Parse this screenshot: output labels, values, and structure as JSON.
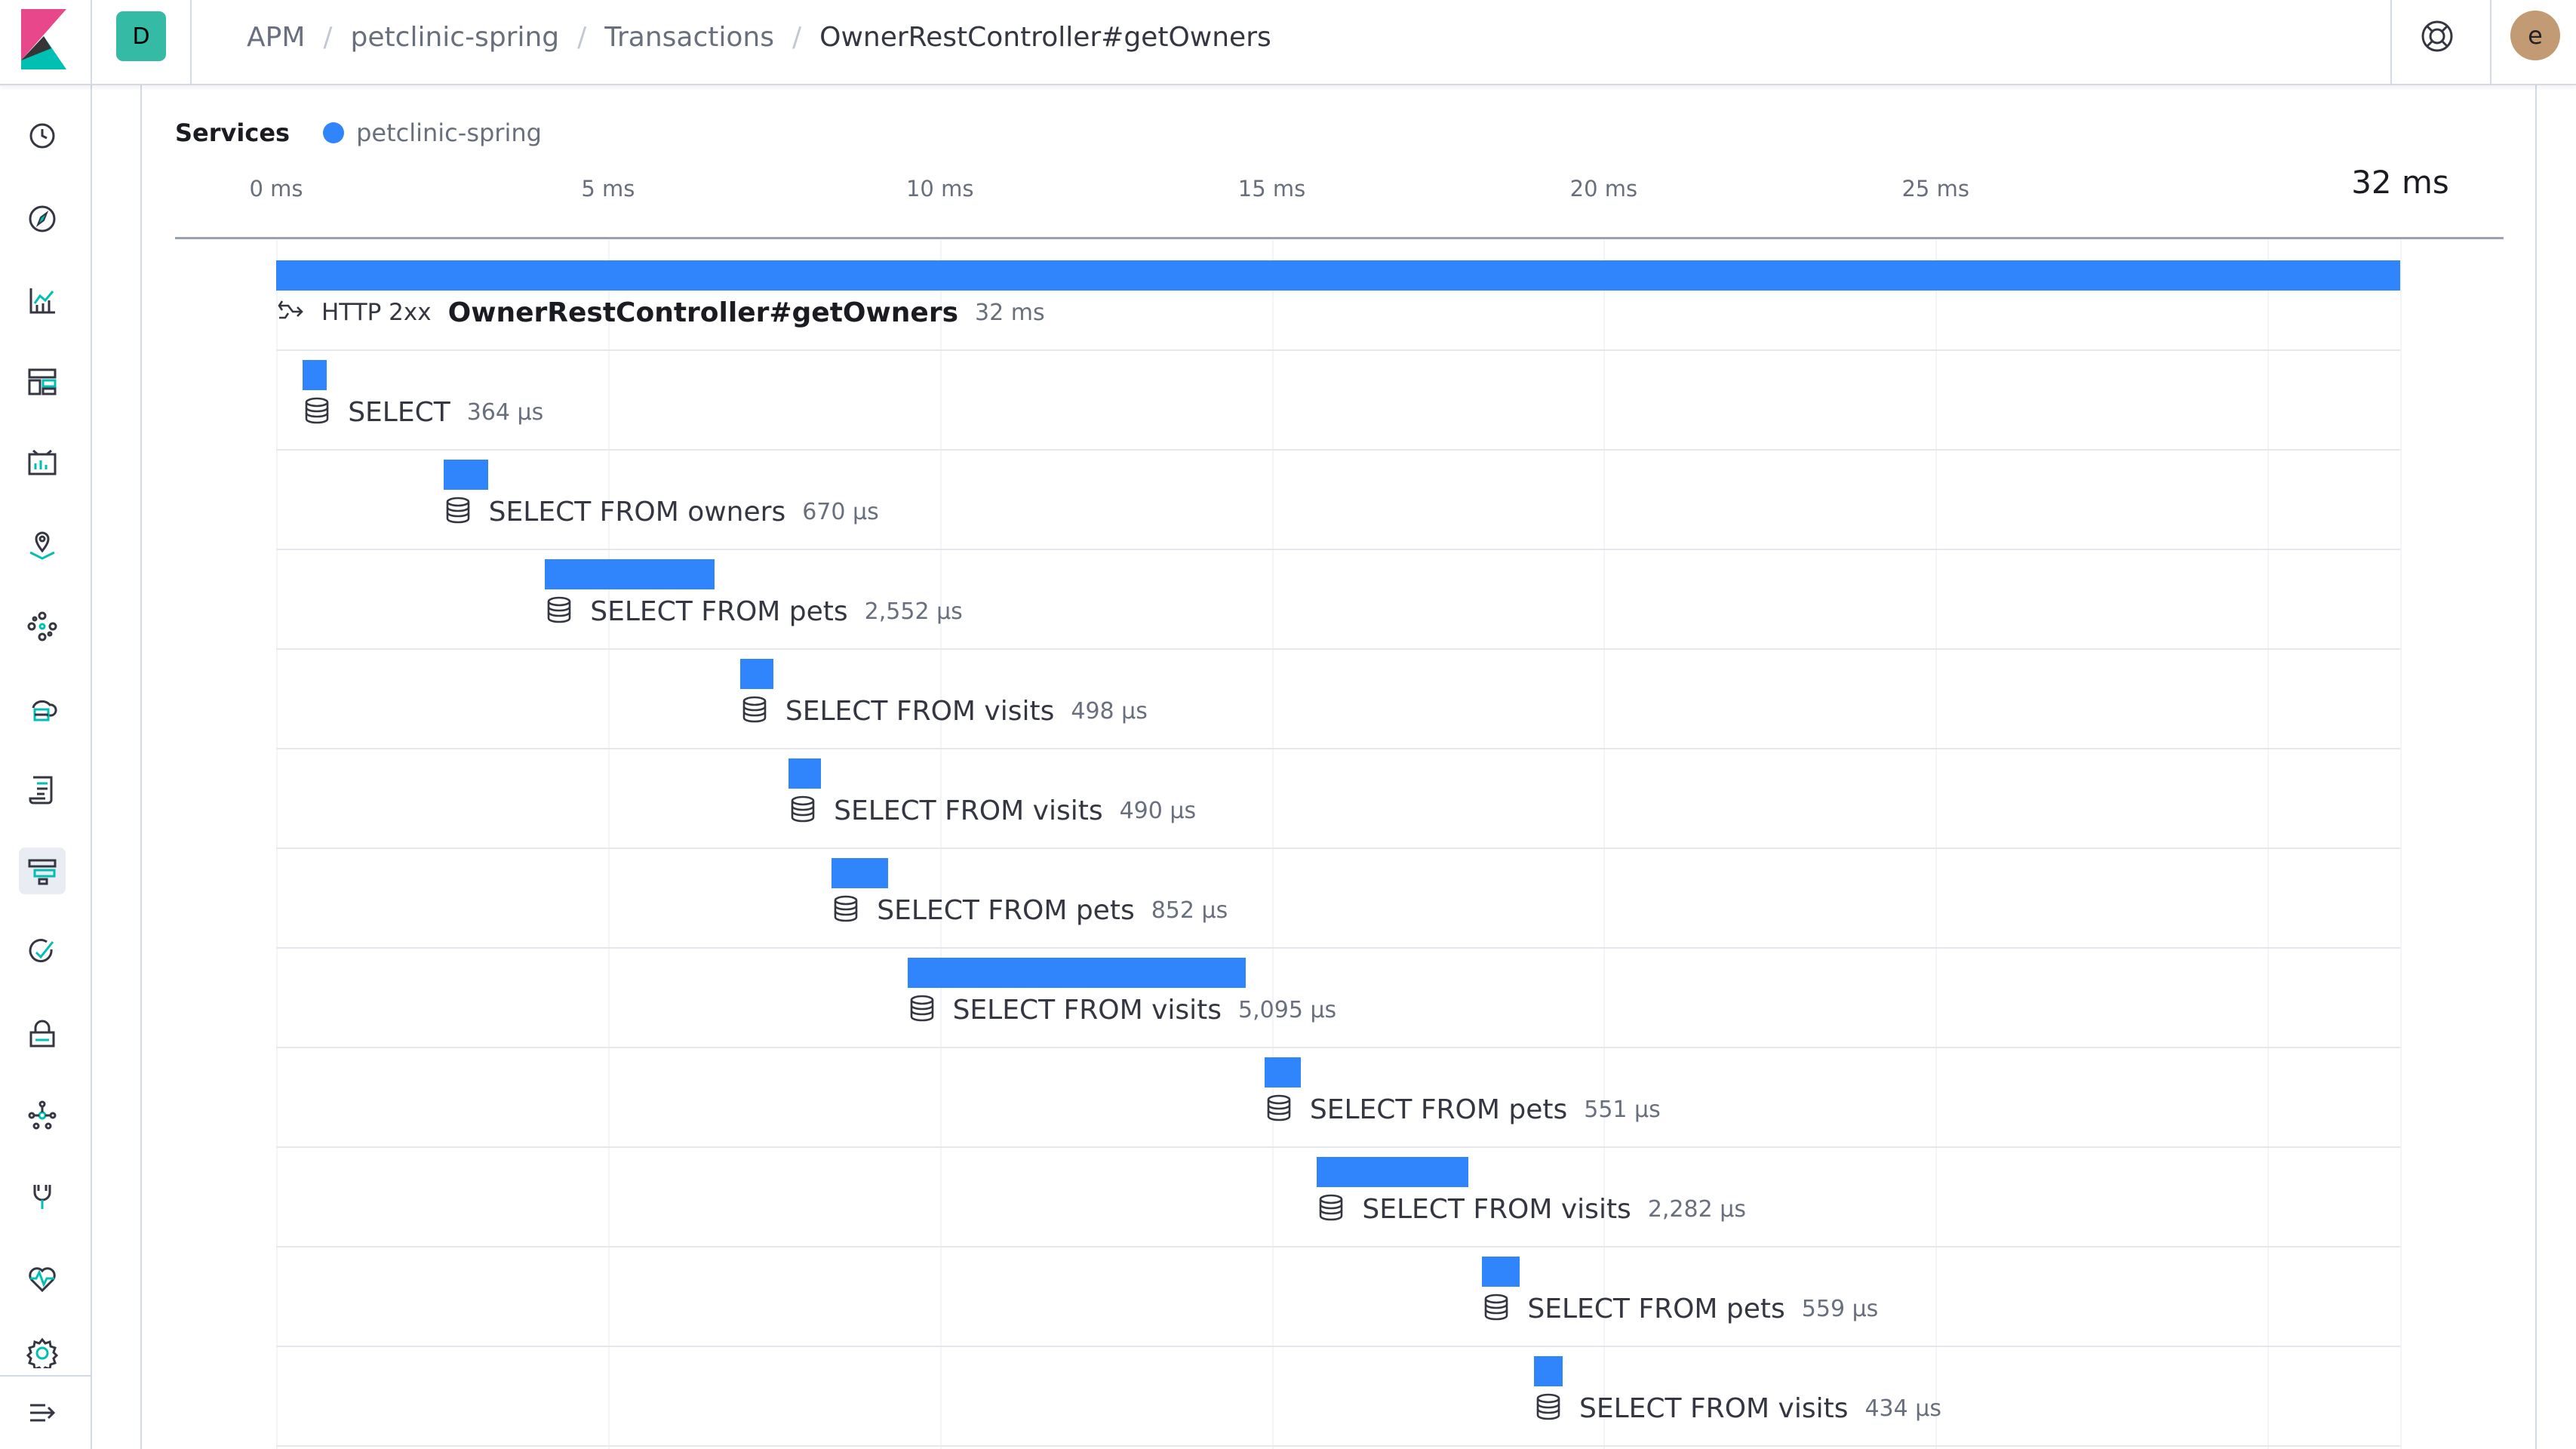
{
  "header": {
    "space_initial": "D",
    "breadcrumbs": [
      "APM",
      "petclinic-spring",
      "Transactions",
      "OwnerRestController#getOwners"
    ],
    "user_initial": "e"
  },
  "nav": {
    "icons": [
      "recently-viewed-icon",
      "discover-icon",
      "visualize-icon",
      "dashboard-icon",
      "canvas-icon",
      "maps-icon",
      "machine-learning-icon",
      "infrastructure-icon",
      "logs-icon",
      "apm-icon",
      "uptime-icon",
      "siem-icon",
      "graph-icon",
      "dev-tools-icon",
      "monitoring-icon",
      "management-icon",
      "collapse-icon"
    ],
    "active": "apm-icon"
  },
  "legend": {
    "title": "Services",
    "service": "petclinic-spring",
    "service_color": "#3185fc"
  },
  "timeline": {
    "ticks": [
      "0 ms",
      "5 ms",
      "10 ms",
      "15 ms",
      "20 ms",
      "25 ms"
    ],
    "end_label": "32 ms",
    "total_ms": 32
  },
  "transaction": {
    "status": "HTTP 2xx",
    "name": "OwnerRestController#getOwners",
    "duration": "32 ms",
    "start_ms": 0,
    "duration_ms": 32
  },
  "spans": [
    {
      "name": "SELECT",
      "duration": "364 μs",
      "start_ms": 0.4,
      "duration_ms": 0.364
    },
    {
      "name": "SELECT FROM owners",
      "duration": "670 μs",
      "start_ms": 2.52,
      "duration_ms": 0.67
    },
    {
      "name": "SELECT FROM pets",
      "duration": "2,552 μs",
      "start_ms": 4.05,
      "duration_ms": 2.552
    },
    {
      "name": "SELECT FROM visits",
      "duration": "498 μs",
      "start_ms": 6.99,
      "duration_ms": 0.498
    },
    {
      "name": "SELECT FROM visits",
      "duration": "490 μs",
      "start_ms": 7.72,
      "duration_ms": 0.49
    },
    {
      "name": "SELECT FROM pets",
      "duration": "852 μs",
      "start_ms": 8.37,
      "duration_ms": 0.852
    },
    {
      "name": "SELECT FROM visits",
      "duration": "5,095 μs",
      "start_ms": 9.51,
      "duration_ms": 5.095
    },
    {
      "name": "SELECT FROM pets",
      "duration": "551 μs",
      "start_ms": 14.89,
      "duration_ms": 0.551
    },
    {
      "name": "SELECT FROM visits",
      "duration": "2,282 μs",
      "start_ms": 15.68,
      "duration_ms": 2.282
    },
    {
      "name": "SELECT FROM pets",
      "duration": "559 μs",
      "start_ms": 18.17,
      "duration_ms": 0.559
    },
    {
      "name": "SELECT FROM visits",
      "duration": "434 μs",
      "start_ms": 18.95,
      "duration_ms": 0.434
    }
  ]
}
